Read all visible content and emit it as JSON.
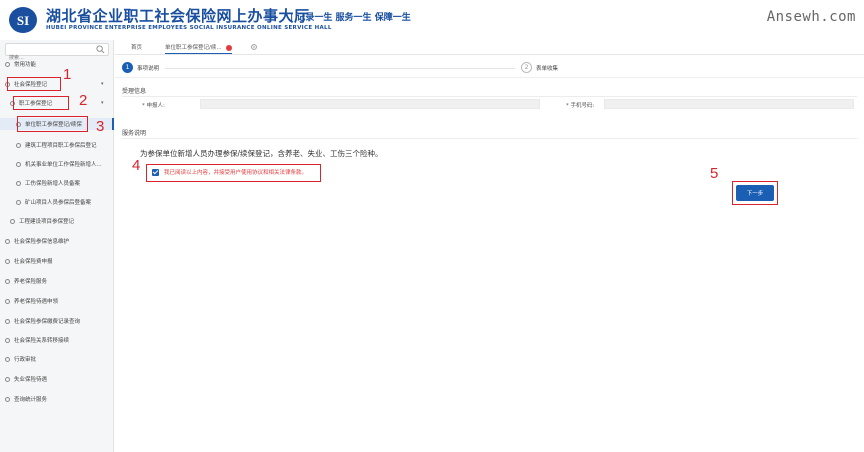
{
  "header": {
    "title": "湖北省企业职工社会保险网上办事大厅",
    "slogan": "| 记录一生  服务一生  保障一生",
    "subtitle": "HUBEI PROVINCE ENTERPRISE EMPLOYEES SOCIAL INSURANCE ONLINE SERVICE HALL",
    "watermark": "Ansewh.com",
    "accent_color": "#1a4fa0"
  },
  "sidebar": {
    "search_placeholder": "搜索...",
    "items": [
      {
        "label": "常用功能"
      },
      {
        "label": "社会保险登记"
      },
      {
        "label": "职工参保登记"
      },
      {
        "label": "单位职工参保登记/续保"
      },
      {
        "label": "建筑工程项目职工参保后登记"
      },
      {
        "label": "机关事业单位工作保险新增人..."
      },
      {
        "label": "工伤保险新增人员备案"
      },
      {
        "label": "矿山项目人员参保后登备案"
      },
      {
        "label": "工程建设项目参保登记"
      },
      {
        "label": "社会保险参保信息维护"
      },
      {
        "label": "社会保险费申报"
      },
      {
        "label": "养老保险服务"
      },
      {
        "label": "养老保险待遇申领"
      },
      {
        "label": "社会保险参保缴费记录查询"
      },
      {
        "label": "社会保险关系转移接续"
      },
      {
        "label": "行政审批"
      },
      {
        "label": "失业保险待遇"
      },
      {
        "label": "查询统计服务"
      }
    ]
  },
  "tabs": {
    "home": "首页",
    "current": "单位职工参保登记/续..."
  },
  "steps": {
    "step1_num": "1",
    "step1_label": "事项说明",
    "step2_num": "2",
    "step2_label": "表单收集"
  },
  "form": {
    "section1": "受理信息",
    "applicant_label": "* 申报人:",
    "phone_label": "* 手机号码:",
    "section2": "服务说明",
    "notice": "为参保单位新增人员办理参保/续保登记，含养老、失业、工伤三个险种。",
    "agree_text": "我已阅读以上内容，并接受用户使用协议和相关法律条款。",
    "next_button": "下一步"
  },
  "annotations": [
    "1",
    "2",
    "3",
    "4",
    "5"
  ],
  "colors": {
    "primary": "#1a5fb4",
    "annotation_red": "#d9232d",
    "agree_red": "#e23b3b"
  }
}
